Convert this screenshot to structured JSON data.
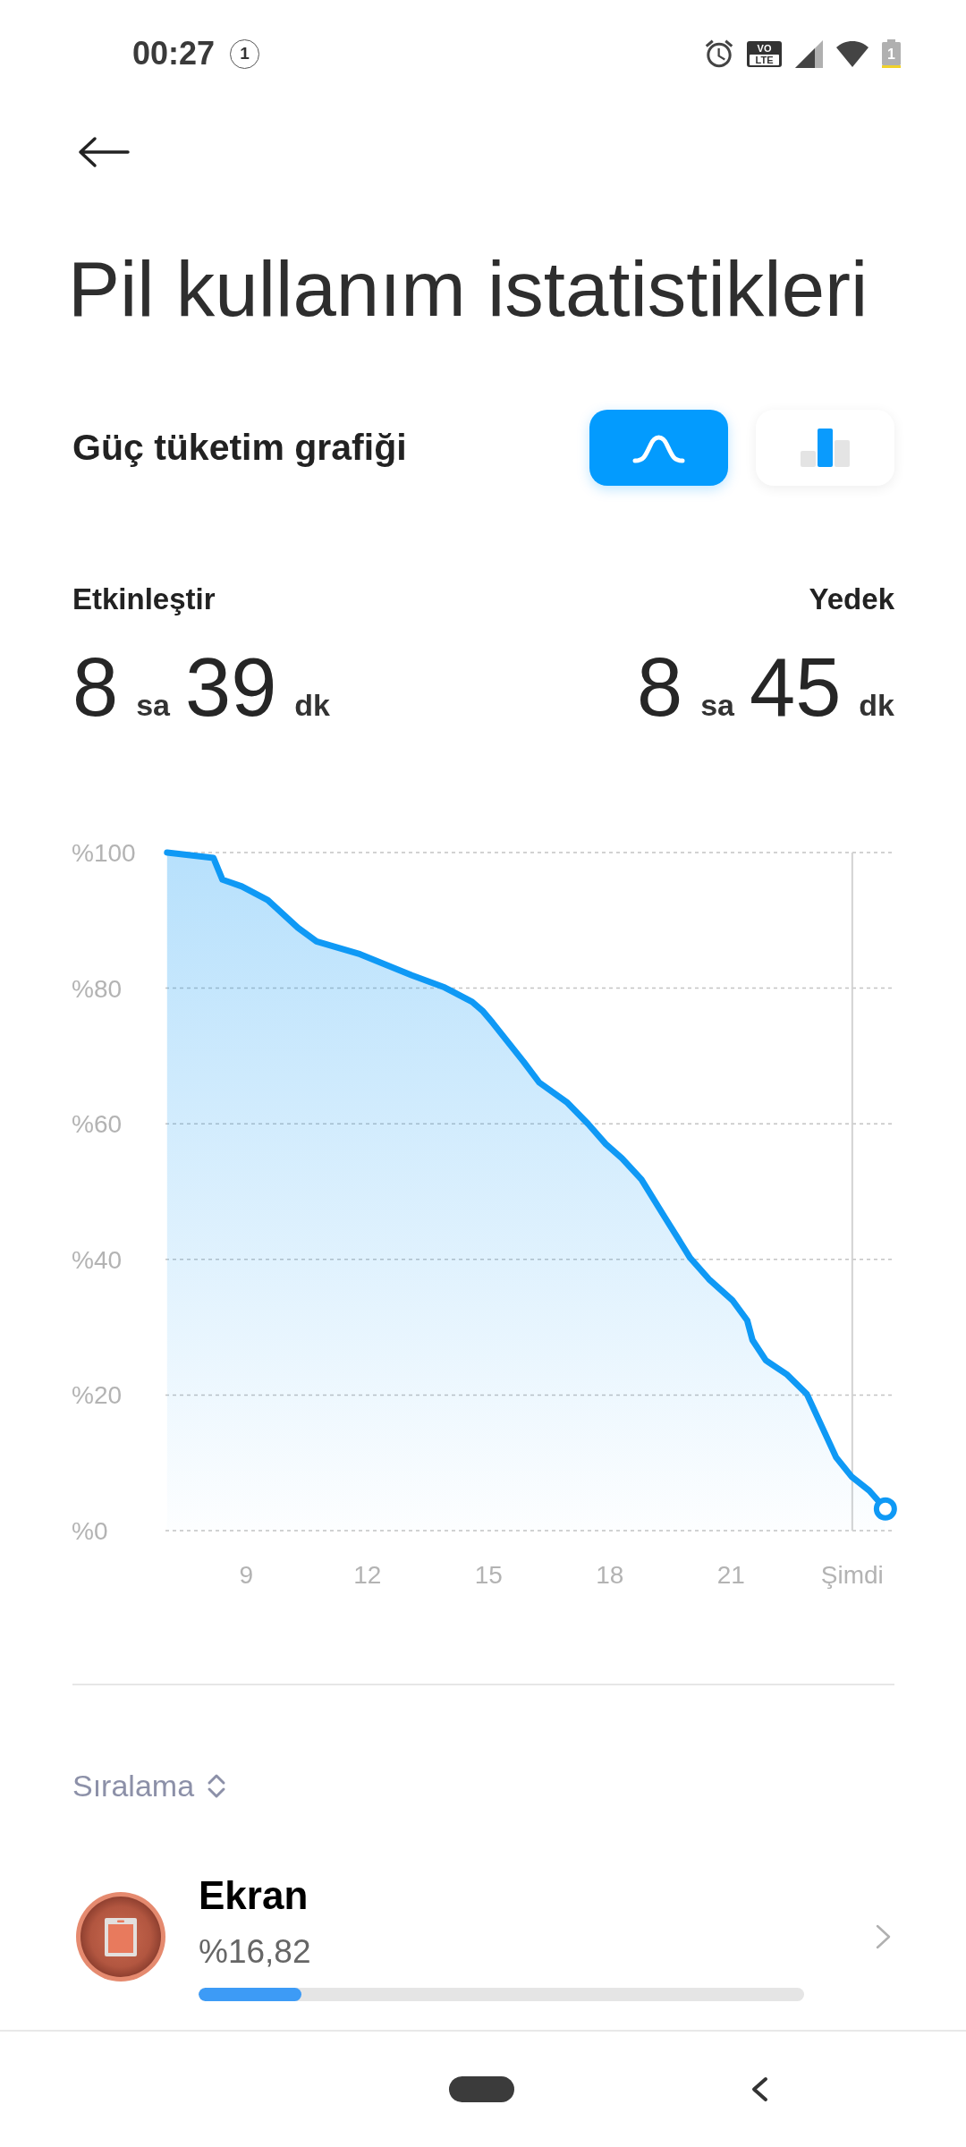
{
  "status_bar": {
    "time": "00:27",
    "notification_count": "1",
    "volte_badge": {
      "top": "VO",
      "bottom": "LTE"
    },
    "battery_label": "1"
  },
  "header": {
    "title": "Pil kullanım istatistikleri"
  },
  "graph_section": {
    "title": "Güç tüketim grafiği",
    "view_toggles": [
      {
        "kind": "curve",
        "selected": true
      },
      {
        "kind": "bars",
        "selected": false
      }
    ]
  },
  "estimates": [
    {
      "label": "Etkinleştir",
      "hours": "8",
      "hours_unit": "sa",
      "minutes": "39",
      "minutes_unit": "dk"
    },
    {
      "label": "Yedek",
      "hours": "8",
      "hours_unit": "sa",
      "minutes": "45",
      "minutes_unit": "dk"
    }
  ],
  "chart": {
    "chart_data": {
      "type": "area",
      "grid": true,
      "x": [
        7.04,
        8.19,
        8.41,
        8.89,
        9.53,
        10.28,
        10.74,
        11.82,
        13.1,
        13.91,
        14.59,
        14.86,
        15.1,
        15.87,
        16.25,
        16.95,
        17.46,
        17.9,
        18.3,
        18.78,
        19.35,
        19.99,
        20.45,
        21.03,
        21.4,
        21.53,
        21.86,
        22.39,
        22.88,
        23.6,
        23.98,
        24.42,
        24.82
      ],
      "series": [
        {
          "color": "#0f99f5",
          "values": [
            100,
            99.2,
            96,
            95,
            93,
            88.9,
            86.9,
            85,
            81.9,
            80.1,
            78,
            76.6,
            74.9,
            69.1,
            66.1,
            63.1,
            60,
            57,
            54.9,
            51.8,
            46.3,
            40.2,
            37.1,
            34,
            31,
            28.1,
            25.1,
            23,
            20.1,
            10.8,
            8,
            5.9,
            3.2
          ]
        }
      ],
      "ref_lines": [
        {
          "axis": "x",
          "value": 24
        }
      ],
      "xlim": [
        7,
        25
      ],
      "ylim": [
        0,
        100
      ],
      "xticks": [
        {
          "value": 9,
          "label": "9"
        },
        {
          "value": 12,
          "label": "12"
        },
        {
          "value": 15,
          "label": "15"
        },
        {
          "value": 18,
          "label": "18"
        },
        {
          "value": 21,
          "label": "21"
        },
        {
          "value": 24,
          "label": "Şimdi"
        }
      ],
      "yticks": [
        {
          "value": 0,
          "label": "%0"
        },
        {
          "value": 20,
          "label": "%20"
        },
        {
          "value": 40,
          "label": "%40"
        },
        {
          "value": 60,
          "label": "%60"
        },
        {
          "value": 80,
          "label": "%80"
        },
        {
          "value": 100,
          "label": "%100"
        }
      ]
    }
  },
  "sort": {
    "label": "Sıralama"
  },
  "usage_items": [
    {
      "name": "Ekran",
      "share": "%16,82",
      "level": 0.17
    }
  ]
}
